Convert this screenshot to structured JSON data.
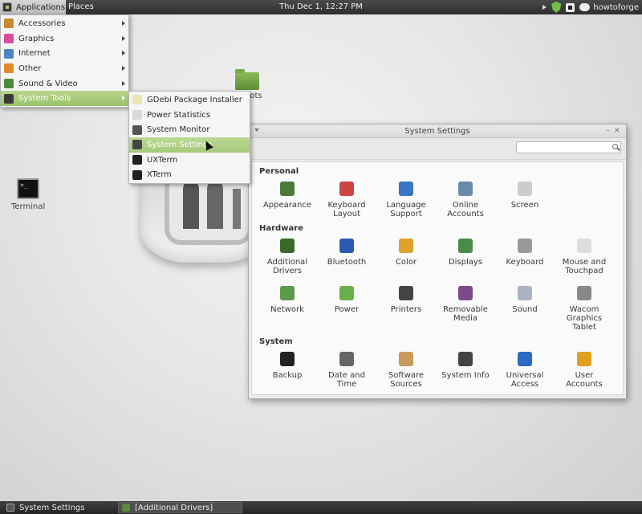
{
  "top_panel": {
    "applications_label": "Applications",
    "places_label": "Places",
    "clock": "Thu Dec  1, 12:27 PM",
    "username": "howtoforge",
    "tray_icons": [
      "volume-icon",
      "shield-icon",
      "battery-icon",
      "chat-icon"
    ]
  },
  "desktop": {
    "terminal_label": "Terminal",
    "folder_label": "ots"
  },
  "app_menu": {
    "items": [
      {
        "label": "Accessories",
        "icon": "accessories-icon",
        "color": "#c8892f"
      },
      {
        "label": "Graphics",
        "icon": "graphics-icon",
        "color": "#d94a9c"
      },
      {
        "label": "Internet",
        "icon": "internet-icon",
        "color": "#4b86c4"
      },
      {
        "label": "Other",
        "icon": "other-icon",
        "color": "#e08a2a"
      },
      {
        "label": "Sound & Video",
        "icon": "sound-video-icon",
        "color": "#4a8a3a"
      },
      {
        "label": "System Tools",
        "icon": "system-tools-icon",
        "color": "#3a3a3a"
      }
    ],
    "active_index": 5
  },
  "system_tools_menu": {
    "items": [
      {
        "label": "GDebi Package Installer",
        "icon": "gdebi-icon",
        "color": "#e6e6b8"
      },
      {
        "label": "Power Statistics",
        "icon": "power-statistics-icon",
        "color": "#d9d9d9"
      },
      {
        "label": "System Monitor",
        "icon": "system-monitor-icon",
        "color": "#555555"
      },
      {
        "label": "System Settings",
        "icon": "system-settings-icon",
        "color": "#444444"
      },
      {
        "label": "UXTerm",
        "icon": "uxterm-icon",
        "color": "#222222"
      },
      {
        "label": "XTerm",
        "icon": "xterm-icon",
        "color": "#222222"
      }
    ],
    "hover_index": 3
  },
  "settings_window": {
    "title": "System Settings",
    "minimize": "–",
    "close": "×",
    "search": {
      "value": "",
      "placeholder": ""
    },
    "sections": [
      {
        "title": "Personal",
        "items": [
          {
            "label": "Appearance",
            "icon": "appearance-icon",
            "color": "#4a7a3a"
          },
          {
            "label": "Keyboard Layout",
            "icon": "keyboard-layout-icon",
            "color": "#c44"
          },
          {
            "label": "Language Support",
            "icon": "language-support-icon",
            "color": "#3a74c4"
          },
          {
            "label": "Online Accounts",
            "icon": "online-accounts-icon",
            "color": "#6a8aaa"
          },
          {
            "label": "Screen",
            "icon": "screen-icon",
            "color": "#cccccc"
          }
        ]
      },
      {
        "title": "Hardware",
        "items": [
          {
            "label": "Additional Drivers",
            "icon": "additional-drivers-icon",
            "color": "#3a6a2a"
          },
          {
            "label": "Bluetooth",
            "icon": "bluetooth-icon",
            "color": "#2a5ab4"
          },
          {
            "label": "Color",
            "icon": "color-icon",
            "color": "#e0a030"
          },
          {
            "label": "Displays",
            "icon": "displays-icon",
            "color": "#4a8a4a"
          },
          {
            "label": "Keyboard",
            "icon": "keyboard-icon",
            "color": "#9a9a9a"
          },
          {
            "label": "Mouse and Touchpad",
            "icon": "mouse-icon",
            "color": "#dddddd"
          },
          {
            "label": "Network",
            "icon": "network-icon",
            "color": "#5a9a4a"
          },
          {
            "label": "Power",
            "icon": "power-icon",
            "color": "#6ab04a"
          },
          {
            "label": "Printers",
            "icon": "printers-icon",
            "color": "#444444"
          },
          {
            "label": "Removable Media",
            "icon": "removable-media-icon",
            "color": "#7a4a8a"
          },
          {
            "label": "Sound",
            "icon": "sound-icon",
            "color": "#aab4c4"
          },
          {
            "label": "Wacom Graphics Tablet",
            "icon": "wacom-icon",
            "color": "#888888"
          }
        ]
      },
      {
        "title": "System",
        "items": [
          {
            "label": "Backup",
            "icon": "backup-icon",
            "color": "#222222"
          },
          {
            "label": "Date and Time",
            "icon": "clock-icon",
            "color": "#666666"
          },
          {
            "label": "Software Sources",
            "icon": "software-sources-icon",
            "color": "#c8995a"
          },
          {
            "label": "System Info",
            "icon": "system-info-icon",
            "color": "#444444"
          },
          {
            "label": "Universal Access",
            "icon": "universal-access-icon",
            "color": "#2a6ac4"
          },
          {
            "label": "User Accounts",
            "icon": "user-accounts-icon",
            "color": "#e0a020"
          }
        ]
      }
    ]
  },
  "bottom_panel": {
    "tasks": [
      {
        "label": "System Settings",
        "icon": "system-settings-icon"
      },
      {
        "label": "[Additional Drivers]",
        "icon": "additional-drivers-icon"
      }
    ]
  }
}
